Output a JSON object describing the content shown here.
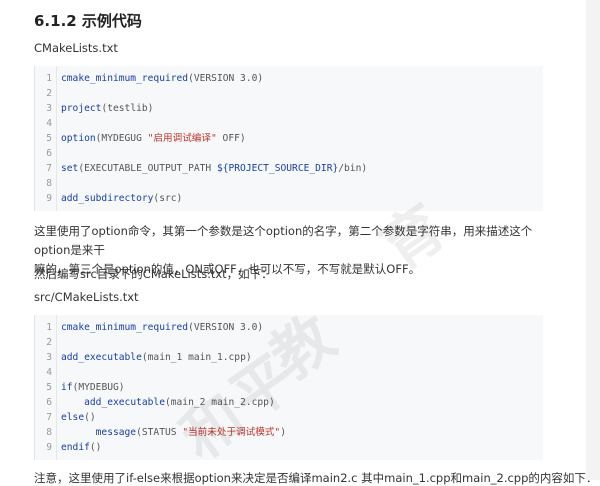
{
  "section_title": "6.1.2 示例代码",
  "file1_label": "CMakeLists.txt",
  "code1": [
    {
      "ln": "1",
      "parts": [
        {
          "c": "fn",
          "t": "cmake_minimum_required"
        },
        {
          "c": "plain",
          "t": "(VERSION 3.0)"
        }
      ]
    },
    {
      "ln": "2",
      "parts": []
    },
    {
      "ln": "3",
      "parts": [
        {
          "c": "fn",
          "t": "project"
        },
        {
          "c": "plain",
          "t": "(testlib)"
        }
      ]
    },
    {
      "ln": "4",
      "parts": []
    },
    {
      "ln": "5",
      "parts": [
        {
          "c": "fn",
          "t": "option"
        },
        {
          "c": "plain",
          "t": "(MYDEGUG "
        },
        {
          "c": "str",
          "t": "\"启用调试编译\""
        },
        {
          "c": "plain",
          "t": " OFF)"
        }
      ]
    },
    {
      "ln": "6",
      "parts": []
    },
    {
      "ln": "7",
      "parts": [
        {
          "c": "fn",
          "t": "set"
        },
        {
          "c": "plain",
          "t": "(EXECUTABLE_OUTPUT_PATH "
        },
        {
          "c": "var",
          "t": "${PROJECT_SOURCE_DIR}"
        },
        {
          "c": "plain",
          "t": "/bin)"
        }
      ]
    },
    {
      "ln": "8",
      "parts": []
    },
    {
      "ln": "9",
      "parts": [
        {
          "c": "fn",
          "t": "add_subdirectory"
        },
        {
          "c": "plain",
          "t": "(src)"
        }
      ]
    }
  ],
  "para1_line1": "这里使用了option命令，其第一个参数是这个option的名字，第二个参数是字符串，用来描述这个option是来干",
  "para1_line2": "嘛的，第三个是option的值，ON或OFF，也可以不写，不写就是默认OFF。",
  "para2": "然后编写src目录下的CMakeLists.txt，如下：",
  "file2_label": "src/CMakeLists.txt",
  "code2": [
    {
      "ln": "1",
      "parts": [
        {
          "c": "fn",
          "t": "cmake_minimum_required"
        },
        {
          "c": "plain",
          "t": "(VERSION 3.0)"
        }
      ]
    },
    {
      "ln": "2",
      "parts": []
    },
    {
      "ln": "3",
      "parts": [
        {
          "c": "fn",
          "t": "add_executable"
        },
        {
          "c": "plain",
          "t": "(main_1 main_1.cpp)"
        }
      ]
    },
    {
      "ln": "4",
      "parts": []
    },
    {
      "ln": "5",
      "parts": [
        {
          "c": "fn",
          "t": "if"
        },
        {
          "c": "plain",
          "t": "(MYDEBUG)"
        }
      ]
    },
    {
      "ln": "6",
      "parts": [
        {
          "c": "plain",
          "t": "    "
        },
        {
          "c": "fn",
          "t": "add_executable"
        },
        {
          "c": "plain",
          "t": "(main_2 main_2.cpp)"
        }
      ]
    },
    {
      "ln": "7",
      "parts": [
        {
          "c": "fn",
          "t": "else"
        },
        {
          "c": "plain",
          "t": "()"
        }
      ]
    },
    {
      "ln": "8",
      "parts": [
        {
          "c": "plain",
          "t": "      "
        },
        {
          "c": "fn",
          "t": "message"
        },
        {
          "c": "plain",
          "t": "(STATUS "
        },
        {
          "c": "str",
          "t": "\"当前未处于调试模式\""
        },
        {
          "c": "plain",
          "t": ")"
        }
      ]
    },
    {
      "ln": "9",
      "parts": [
        {
          "c": "fn",
          "t": "endif"
        },
        {
          "c": "plain",
          "t": "()"
        }
      ]
    }
  ],
  "para3_partial": "注意，这里使用了if-else来根据option来决定是否编译main2.c 其中main_1.cpp和main_2.cpp的内容如下：",
  "watermark_chars": [
    "教",
    "和",
    "平",
    "育"
  ]
}
